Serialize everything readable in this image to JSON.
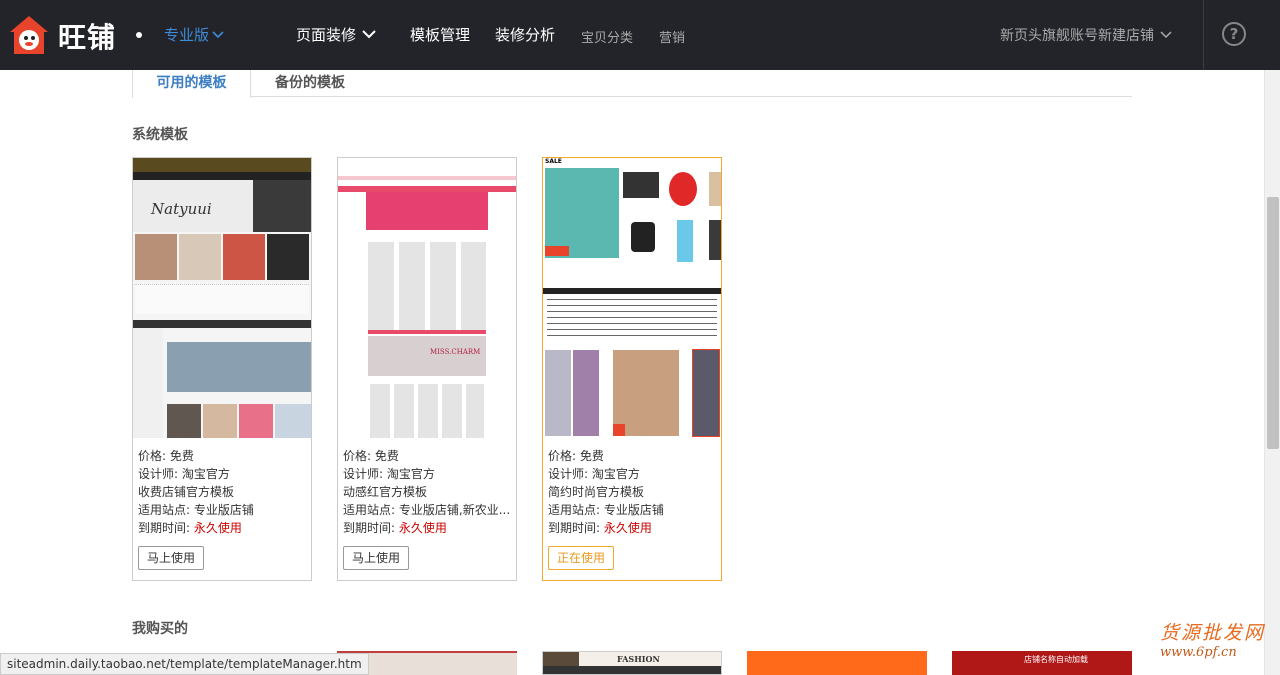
{
  "header": {
    "brand": "旺铺",
    "edition": "专业版",
    "nav": [
      {
        "label": "页面装修"
      },
      {
        "label": "模板管理"
      },
      {
        "label": "装修分析"
      },
      {
        "label": "宝贝分类"
      },
      {
        "label": "营销"
      }
    ],
    "shop_name": "新页头旗舰账号新建店铺",
    "help_glyph": "?",
    "icons": {
      "logo": "wangpu-logo-icon",
      "dropdown": "chevron-down-icon",
      "help": "help-circle-icon"
    }
  },
  "tabs": [
    {
      "label": "可用的模板",
      "active": true
    },
    {
      "label": "备份的模板",
      "active": false
    }
  ],
  "sections": {
    "system": "系统模板",
    "purchased": "我购买的"
  },
  "templates": [
    {
      "price_label": "价格:",
      "price": "免费",
      "designer_label": "设计师:",
      "designer": "淘宝官方",
      "name": "收费店铺官方模板",
      "site_label": "适用站点:",
      "site": "专业版店铺",
      "expire_label": "到期时间:",
      "expire": "永久使用",
      "button": "马上使用",
      "thumb_text": "Natyuui"
    },
    {
      "price_label": "价格:",
      "price": "免费",
      "designer_label": "设计师:",
      "designer": "淘宝官方",
      "name": "动感红官方模板",
      "site_label": "适用站点:",
      "site": "专业版店铺,新农业...",
      "expire_label": "到期时间:",
      "expire": "永久使用",
      "button": "马上使用",
      "thumb_text": "MISS.CHARM"
    },
    {
      "price_label": "价格:",
      "price": "免费",
      "designer_label": "设计师:",
      "designer": "淘宝官方",
      "name": "简约时尚官方模板",
      "site_label": "适用站点:",
      "site": "专业版店铺",
      "expire_label": "到期时间:",
      "expire": "永久使用",
      "button": "正在使用",
      "thumb_text": "SALE"
    }
  ],
  "purchased_thumbs": [
    {
      "text": ""
    },
    {
      "text": "FASHION"
    },
    {
      "text": ""
    },
    {
      "text": "店铺名称自动加载"
    }
  ],
  "status_url": "siteadmin.daily.taobao.net/template/templateManager.htm",
  "watermark": {
    "line1": "货源批发网",
    "line2": "www.6pf.cn"
  },
  "colors": {
    "topbar": "#232429",
    "accent_blue": "#3d8bd9",
    "current_border": "#f0a830",
    "expire_red": "#cc0000"
  }
}
